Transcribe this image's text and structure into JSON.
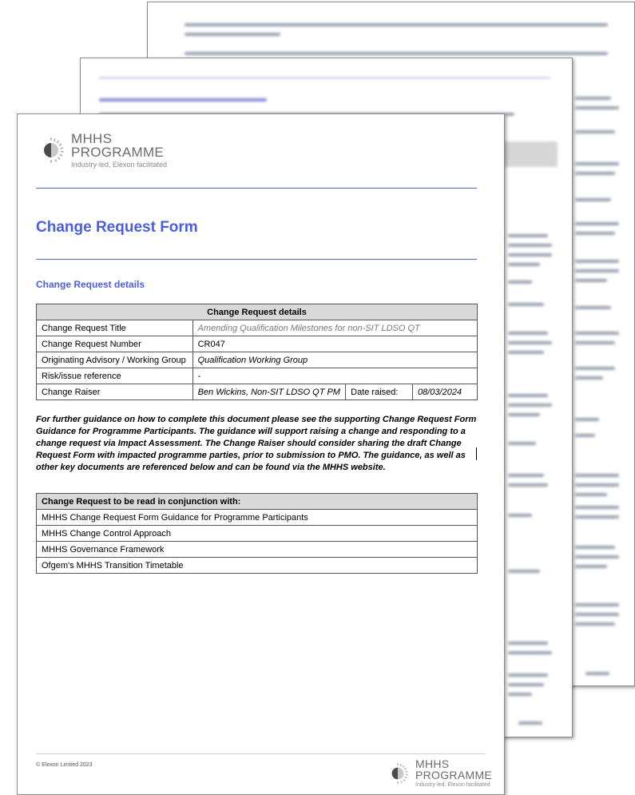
{
  "logo": {
    "line1": "MHHS",
    "line2": "PROGRAMME",
    "tagline": "Industry-led, Elexon facilitated",
    "icon": "half-sun-icon"
  },
  "title": "Change Request Form",
  "section_heading": "Change Request details",
  "details_table": {
    "header": "Change Request details",
    "rows": [
      {
        "label": "Change Request Title",
        "value": "Amending Qualification Milestones for non-SIT LDSO QT"
      },
      {
        "label": "Change Request Number",
        "value": "CR047"
      },
      {
        "label": "Originating Advisory / Working Group",
        "value": "Qualification Working Group"
      },
      {
        "label": "Risk/issue reference",
        "value": "-"
      },
      {
        "label": "Change Raiser",
        "value": "Ben Wickins, Non-SIT LDSO QT PM",
        "date_label": "Date raised:",
        "date_value": "08/03/2024"
      }
    ]
  },
  "guidance_text": "For further guidance on how to complete this document please see the supporting Change Request Form Guidance for Programme Participants. The guidance will support raising a change and responding to a change request via Impact Assessment. The Change Raiser should consider sharing the draft Change Request Form with impacted programme parties, prior to submission to PMO. The guidance, as well as other key documents are referenced below and can be found via the MHHS website.",
  "conjunction_table": {
    "header": "Change Request to be read in conjunction with:",
    "rows": [
      "MHHS Change Request Form Guidance for Programme Participants",
      "MHHS Change Control Approach",
      "MHHS Governance Framework",
      "Ofgem's MHHS Transition Timetable"
    ]
  },
  "footer": {
    "copyright": "© Elexon Limited 2023"
  }
}
